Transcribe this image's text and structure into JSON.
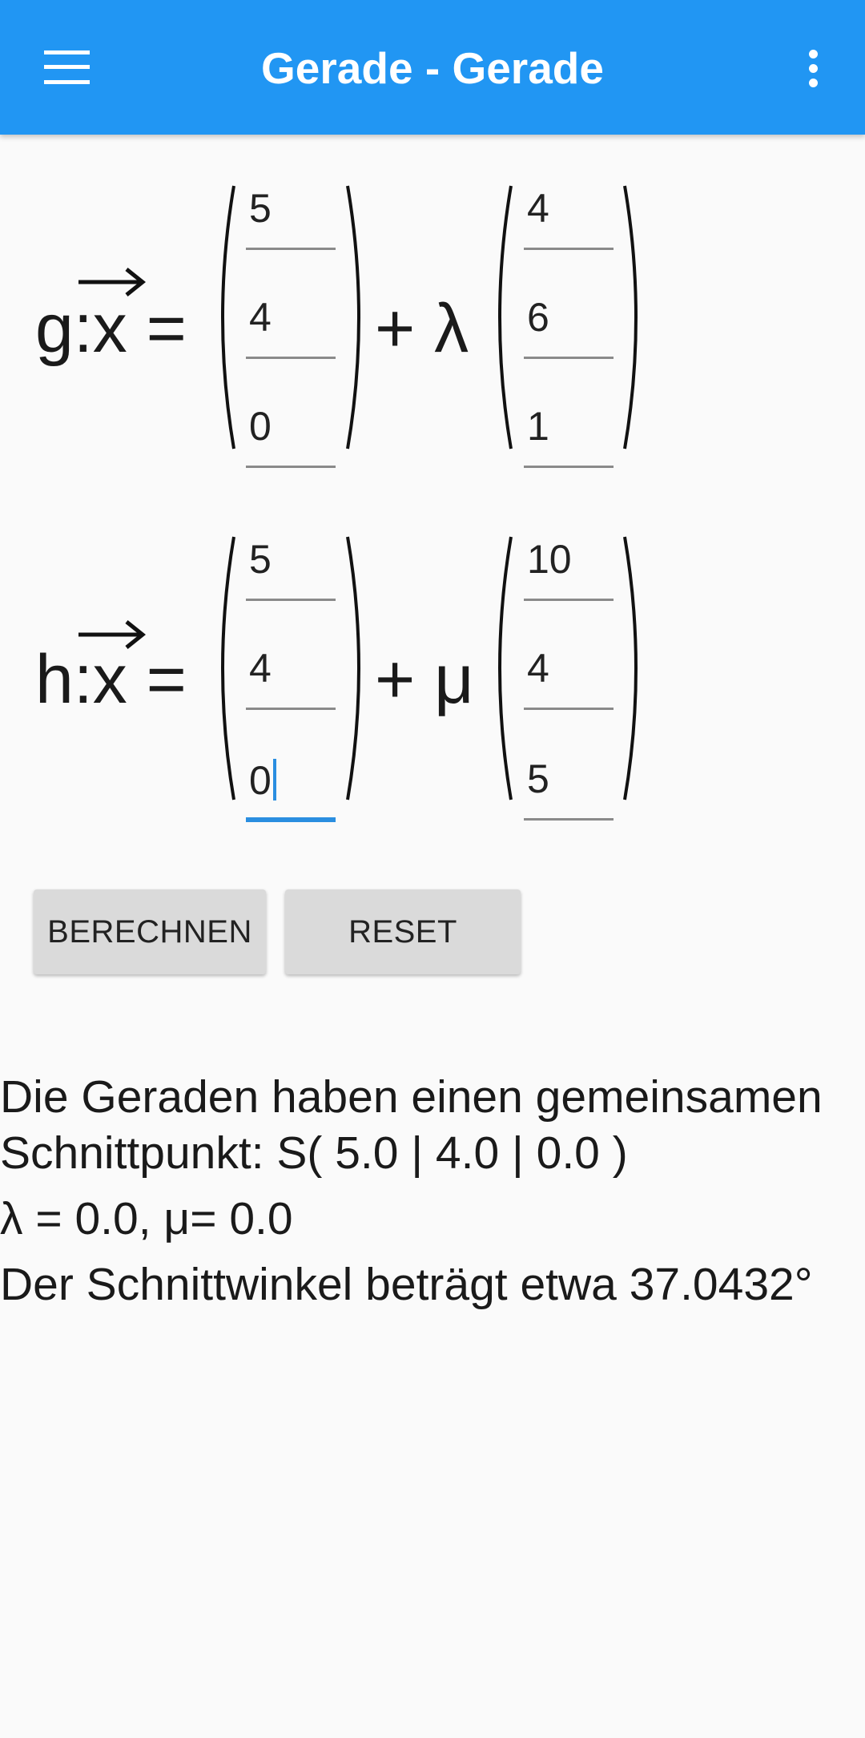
{
  "app_bar": {
    "title": "Gerade - Gerade",
    "menu_icon": "hamburger-menu-icon",
    "overflow_icon": "more-vertical-icon",
    "color": "#2196f3"
  },
  "line_g": {
    "label": "g:x =",
    "operator": "+ λ",
    "support_vector": [
      "5",
      "4",
      "0"
    ],
    "direction_vector": [
      "4",
      "6",
      "1"
    ]
  },
  "line_h": {
    "label": "h:x =",
    "operator": "+ μ",
    "support_vector": [
      "5",
      "4",
      "0"
    ],
    "direction_vector": [
      "10",
      "4",
      "5"
    ]
  },
  "buttons": {
    "calculate": "BERECHNEN",
    "reset": "RESET"
  },
  "result": {
    "line1": "Die Geraden haben einen gemeinsamen",
    "line2": "Schnittpunkt: S( 5.0 | 4.0 | 0.0 )",
    "line3": "λ = 0.0, μ= 0.0",
    "line4": "Der Schnittwinkel beträgt etwa 37.0432°"
  },
  "accent_color": "#2a8ee0"
}
